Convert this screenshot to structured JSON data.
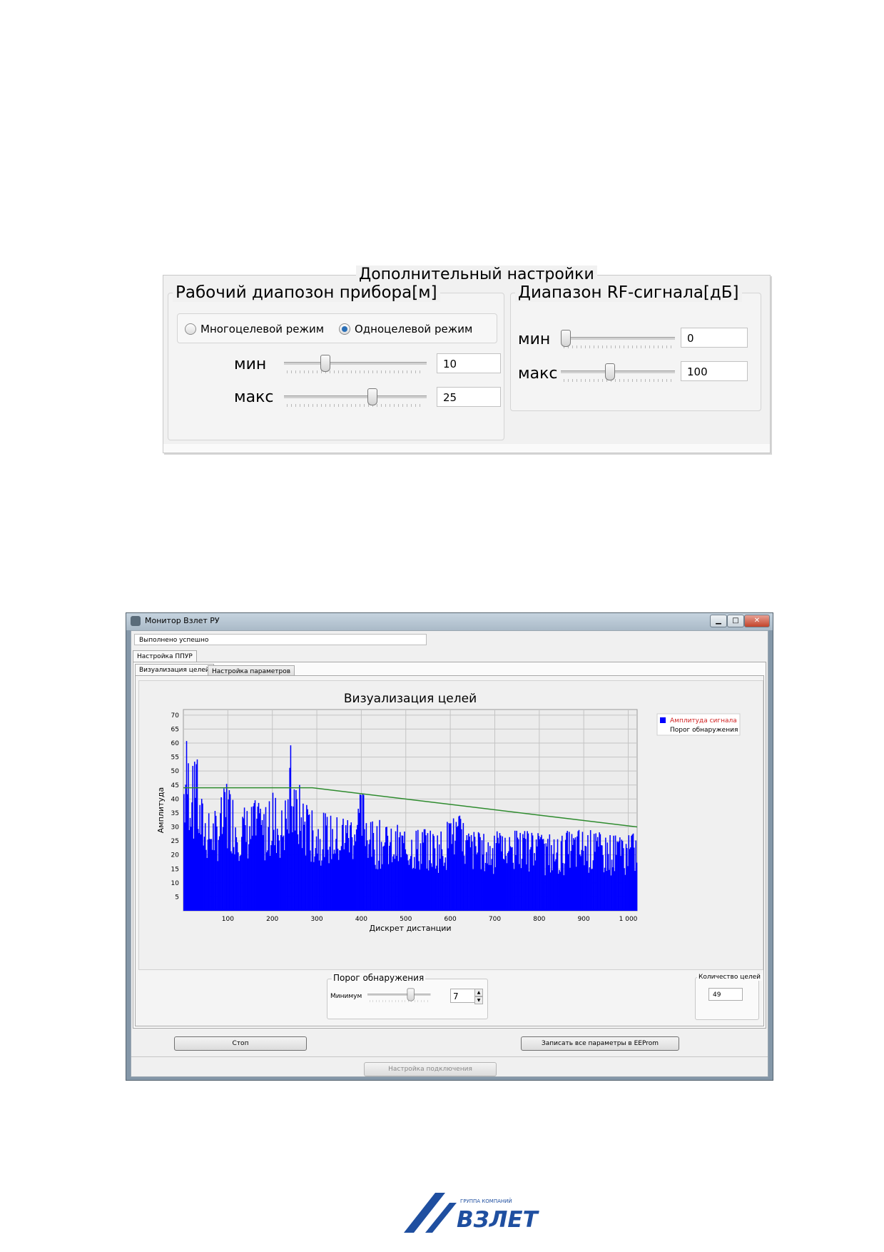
{
  "settings": {
    "title": "Дополнительный настройки",
    "range_group": {
      "title": "Рабочий диапозон прибора[м]",
      "radio_multi": "Многоцелевой режим",
      "radio_single": "Одноцелевой режим",
      "selected_mode": "single",
      "min_label": "мин",
      "min_value": "10",
      "max_label": "макс",
      "max_value": "25",
      "min_slider_fraction": 0.27,
      "max_slider_fraction": 0.62
    },
    "rf_group": {
      "title": "Диапазон RF-сигнала[дБ]",
      "min_label": "мин",
      "min_value": "0",
      "max_label": "макс",
      "max_value": "100",
      "min_slider_fraction": 0.0,
      "max_slider_fraction": 0.42
    }
  },
  "window": {
    "title": "Монитор Взлет РУ",
    "status": "Выполнено успешно",
    "outer_tab": "Настройка ППУР",
    "tabs": [
      "Визуализация целей",
      "Настройка параметров"
    ],
    "active_tab": 0,
    "threshold_group": {
      "title": "Порог обнаружения",
      "min_label": "Минимум",
      "value": "7",
      "slider_fraction": 0.7
    },
    "targets_group": {
      "title": "Количество целей",
      "value": "49"
    },
    "stop_button": "Стоп",
    "write_button": "Записать все параметры в EEProm",
    "connection_button": "Настройка подключения"
  },
  "chart_data": {
    "type": "bar",
    "title": "Визуализация целей",
    "xlabel": "Дискрет дистанции",
    "ylabel": "Амплитуда",
    "xlim": [
      0,
      1020
    ],
    "ylim": [
      0,
      72
    ],
    "x_ticks": [
      "100",
      "200",
      "300",
      "400",
      "500",
      "600",
      "700",
      "800",
      "900",
      "1 000"
    ],
    "y_ticks": [
      "5",
      "10",
      "15",
      "20",
      "25",
      "30",
      "35",
      "40",
      "45",
      "50",
      "55",
      "60",
      "65",
      "70"
    ],
    "grid": true,
    "legend_position": "top-right",
    "series": [
      {
        "name": "Амплитуда сигнала",
        "color": "#0000ff",
        "anchor_points": [
          [
            0,
            58
          ],
          [
            4,
            65
          ],
          [
            10,
            60
          ],
          [
            16,
            56
          ],
          [
            22,
            50
          ],
          [
            28,
            64
          ],
          [
            34,
            44
          ],
          [
            50,
            38
          ],
          [
            70,
            36
          ],
          [
            90,
            44
          ],
          [
            96,
            49
          ],
          [
            104,
            46
          ],
          [
            120,
            40
          ],
          [
            140,
            38
          ],
          [
            160,
            40
          ],
          [
            180,
            37
          ],
          [
            200,
            44
          ],
          [
            220,
            38
          ],
          [
            236,
            48
          ],
          [
            240,
            61
          ],
          [
            246,
            44
          ],
          [
            260,
            46
          ],
          [
            280,
            37
          ],
          [
            300,
            36
          ],
          [
            330,
            35
          ],
          [
            360,
            34
          ],
          [
            380,
            38
          ],
          [
            405,
            45
          ],
          [
            420,
            33
          ],
          [
            460,
            32
          ],
          [
            500,
            31
          ],
          [
            540,
            30
          ],
          [
            580,
            30
          ],
          [
            610,
            37
          ],
          [
            640,
            30
          ],
          [
            680,
            28
          ],
          [
            720,
            29
          ],
          [
            760,
            29
          ],
          [
            800,
            28
          ],
          [
            840,
            27
          ],
          [
            880,
            30
          ],
          [
            900,
            30
          ],
          [
            940,
            28
          ],
          [
            980,
            28
          ],
          [
            1010,
            28
          ],
          [
            1020,
            28
          ]
        ]
      },
      {
        "name": "Порог обнаружения",
        "color": "#2e8b2e",
        "points": [
          [
            0,
            44
          ],
          [
            290,
            44
          ],
          [
            1020,
            30
          ]
        ]
      }
    ]
  },
  "logo": {
    "caption": "ГРУППА КОМПАНИЙ",
    "brand": "ВЗЛЕТ",
    "color": "#1f4fa0"
  }
}
